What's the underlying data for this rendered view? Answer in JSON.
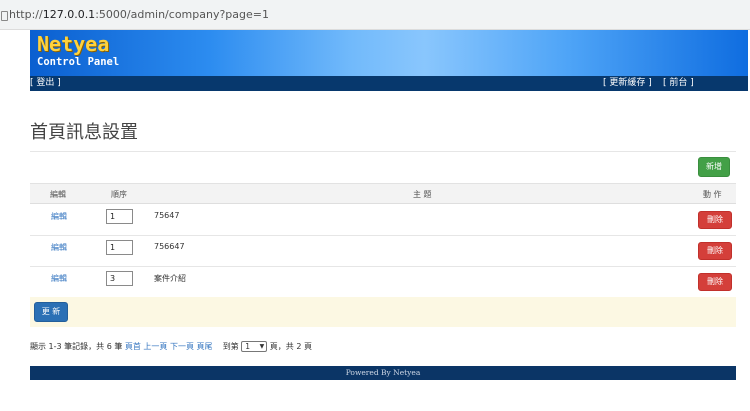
{
  "browser": {
    "url_prefix": "http://",
    "url_host": "127.0.0.1",
    "url_rest": ":5000/admin/company?page=1"
  },
  "header": {
    "logo": "Netyea",
    "subtitle": "Control Panel"
  },
  "nav": {
    "logout": "[ 登出 ]",
    "update_cache": "[ 更新緩存 ]",
    "front": "[ 前台 ]"
  },
  "page": {
    "title": "首頁訊息設置",
    "add_button": "新增"
  },
  "table": {
    "headers": {
      "edit": "編輯",
      "order": "順序",
      "subject": "主 題",
      "action": "動 作"
    },
    "rows": [
      {
        "edit": "編輯",
        "order": "1",
        "subject": "75647",
        "delete": "刪除"
      },
      {
        "edit": "編輯",
        "order": "1",
        "subject": "756647",
        "delete": "刪除"
      },
      {
        "edit": "編輯",
        "order": "3",
        "subject": "案件介紹",
        "delete": "刪除"
      }
    ],
    "update_button": "更 新"
  },
  "pagination": {
    "summary": "顯示 1-3 筆記錄，共 6 筆",
    "first": "頁首",
    "prev": "上一頁",
    "next": "下一頁",
    "last": "頁尾",
    "goto_prefix": "到第",
    "page_value": "1",
    "goto_suffix": "頁，共 2 頁"
  },
  "footer": {
    "powered": "Powered By Netyea"
  },
  "colors": {
    "nav_bg": "#07386d",
    "logo": "#ffd23c",
    "add_button": "#43a047",
    "delete_button": "#d43f3a",
    "update_button": "#2b70b5",
    "link": "#3576c0"
  }
}
